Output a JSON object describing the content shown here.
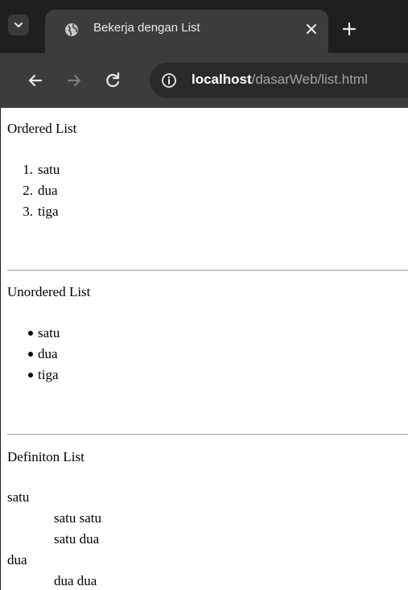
{
  "browser": {
    "tab_title": "Bekerja dengan List",
    "url_host": "localhost",
    "url_path": "/dasarWeb/list.html"
  },
  "page": {
    "ordered": {
      "heading": "Ordered List",
      "items": [
        {
          "num": "1.",
          "text": "satu"
        },
        {
          "num": "2.",
          "text": "dua"
        },
        {
          "num": "3.",
          "text": "tiga"
        }
      ]
    },
    "unordered": {
      "heading": "Unordered List",
      "items": [
        "satu",
        "dua",
        "tiga"
      ]
    },
    "definition": {
      "heading": "Definiton List",
      "terms": [
        {
          "term": "satu",
          "defs": [
            "satu satu",
            "satu dua"
          ]
        },
        {
          "term": "dua",
          "defs": [
            "dua dua"
          ]
        }
      ]
    }
  },
  "icons": {
    "tab_search": "chevron-down-icon",
    "favicon": "globe-icon",
    "close": "close-icon",
    "new_tab": "plus-icon",
    "back": "arrow-left-icon",
    "forward": "arrow-right-icon",
    "reload": "reload-icon",
    "site_info": "info-icon"
  },
  "colors": {
    "tabbar_bg": "#1f1f1f",
    "toolbar_bg": "#3c3c3c",
    "omnibox_bg": "#2a2a2a"
  }
}
